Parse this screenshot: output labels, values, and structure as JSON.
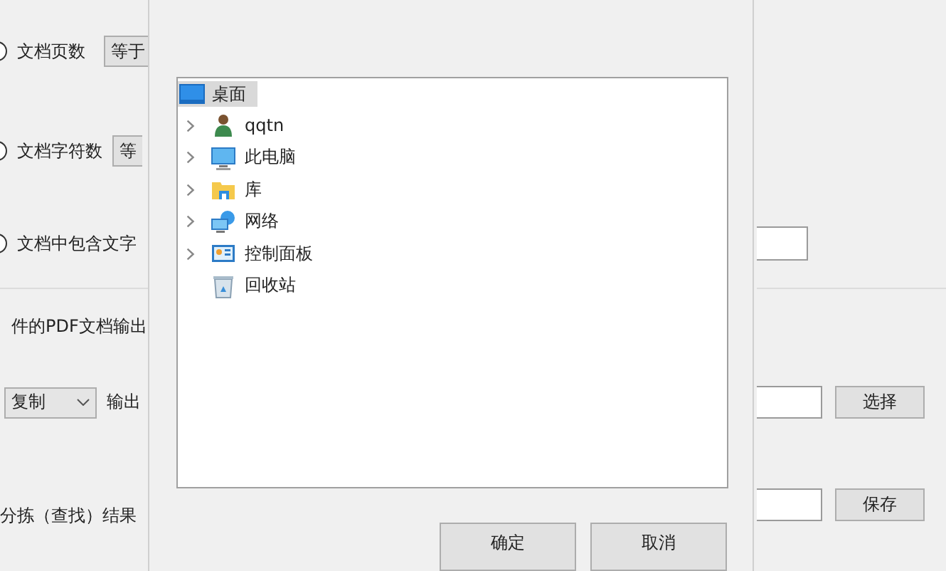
{
  "background_form": {
    "rows": [
      {
        "label": "文档页数",
        "combo": "等于",
        "kind": "radio-combo",
        "selected": false
      },
      {
        "label": "文档字符数",
        "combo": "等",
        "kind": "radio-combo",
        "selected": false
      },
      {
        "label": "文档中包含文字",
        "kind": "radio-field",
        "selected": false
      }
    ],
    "output_label": "件的PDF文档输出",
    "mode_select": "复制",
    "path_label": "输出",
    "choose_button": "选择",
    "result_label": "分拣（查找）结果",
    "save_button": "保存"
  },
  "dialog": {
    "tree": [
      {
        "label": "桌面",
        "kind": "desktop",
        "selected": true,
        "children": [
          {
            "label": "qqtn",
            "kind": "user",
            "selected": false,
            "expandable": true
          },
          {
            "label": "此电脑",
            "kind": "computer",
            "selected": false,
            "expandable": true
          },
          {
            "label": "库",
            "kind": "library",
            "selected": false,
            "expandable": true
          },
          {
            "label": "网络",
            "kind": "network",
            "selected": false,
            "expandable": true
          },
          {
            "label": "控制面板",
            "kind": "control-panel",
            "selected": false,
            "expandable": true
          },
          {
            "label": "回收站",
            "kind": "recycle-bin",
            "selected": false,
            "expandable": false
          }
        ]
      }
    ],
    "buttons": [
      "确定",
      "取消"
    ]
  }
}
